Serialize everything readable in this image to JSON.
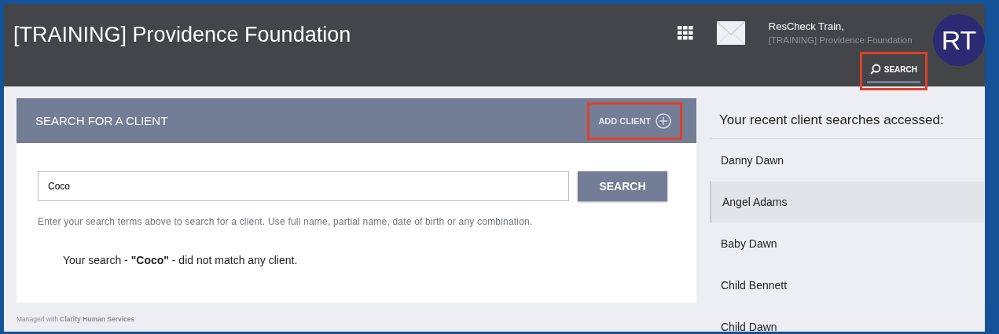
{
  "header": {
    "title": "[TRAINING] Providence Foundation",
    "user_name": "ResCheck Train,",
    "user_org": "[TRAINING] Providence Foundation",
    "avatar_initials": "RT",
    "search_tab": {
      "label": "SEARCH",
      "selected": true,
      "highlighted": true
    }
  },
  "search_panel": {
    "title": "SEARCH FOR A CLIENT",
    "add_client": {
      "label": "ADD CLIENT",
      "highlighted": true
    },
    "field_value": "Coco",
    "search_button": "SEARCH",
    "hint": "Enter your search terms above to search for a client. Use full name, partial name, date of birth or any combination.",
    "result_message": "Your search - **\"Coco\"** - did not match any client."
  },
  "footer": "Managed with **Clarity Human Services**",
  "recent": {
    "title": "Your recent client searches accessed:",
    "items": [
      {
        "name": "Danny Dawn",
        "selected": false
      },
      {
        "name": "Angel Adams",
        "selected": true
      },
      {
        "name": "Baby Dawn",
        "selected": false
      },
      {
        "name": "Child Bennett",
        "selected": false
      },
      {
        "name": "Child Dawn",
        "selected": false
      }
    ]
  }
}
